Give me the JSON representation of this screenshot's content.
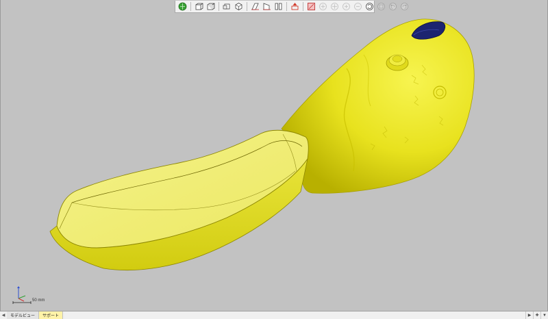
{
  "toolbar": {
    "buttons": [
      {
        "name": "globe-view-icon",
        "color": "#3aa335"
      },
      {
        "name": "cube-front-view-icon"
      },
      {
        "name": "cube-top-view-icon"
      },
      {
        "name": "cube-side-view-icon"
      },
      {
        "name": "cube-iso-view-icon"
      },
      {
        "name": "section-plane-icon"
      },
      {
        "name": "section-plane-alt-icon"
      },
      {
        "name": "parallel-bars-icon"
      },
      {
        "name": "clipping-box-icon",
        "color": "#d23a2a"
      },
      {
        "name": "measure-distance-icon"
      },
      {
        "name": "measure-angle-icon"
      },
      {
        "name": "pan-icon"
      },
      {
        "name": "zoom-in-icon"
      },
      {
        "name": "zoom-out-icon"
      },
      {
        "name": "rotate-icon"
      },
      {
        "name": "fit-view-icon"
      },
      {
        "name": "undo-view-icon"
      },
      {
        "name": "redo-view-icon"
      }
    ]
  },
  "viewport": {
    "background": "#c2c2c2",
    "model_color": "#f2ee3a",
    "seat_color": "#f0ed70",
    "cap_color": "#1c2470"
  },
  "triad": {
    "scale_label": "50 mm",
    "axis_colors": {
      "x": "#d03030",
      "y": "#30a030",
      "z": "#3050d0"
    }
  },
  "tabs": {
    "items": [
      {
        "label": "モデルビュー",
        "active": false
      },
      {
        "label": "サポート",
        "active": true
      }
    ]
  }
}
